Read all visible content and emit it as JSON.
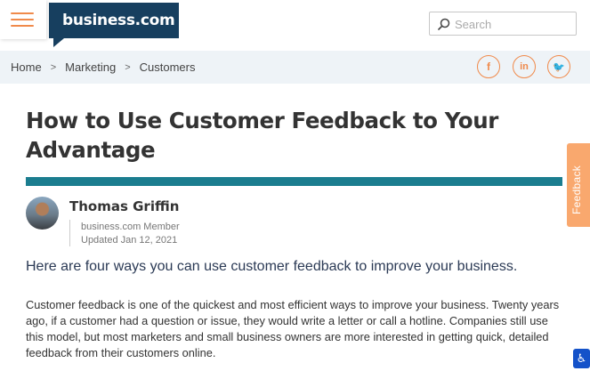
{
  "header": {
    "logo_text": "business.com",
    "search_placeholder": "Search"
  },
  "breadcrumb": {
    "items": [
      "Home",
      "Marketing",
      "Customers"
    ],
    "separator": ">"
  },
  "social": [
    {
      "icon": "facebook-icon",
      "glyph": "f"
    },
    {
      "icon": "linkedin-icon",
      "glyph": "in"
    },
    {
      "icon": "twitter-icon",
      "glyph": "🐦"
    }
  ],
  "article": {
    "title": "How to Use Customer Feedback to Your Advantage",
    "author": "Thomas Griffin",
    "author_role": "business.com Member",
    "updated": "Updated Jan 12, 2021",
    "lead": "Here are four ways you can use customer feedback to improve your business.",
    "body": "Customer feedback is one of the quickest and most efficient ways to improve your business. Twenty years ago, if a customer had a question or issue, they would write a letter or call a hotline. Companies still use this model, but most marketers and small business owners are more interested in getting quick, detailed feedback from their customers online."
  },
  "feedback_tab": "Feedback",
  "colors": {
    "accent": "#f08a4b",
    "logo_bg": "#173f5f",
    "rule": "#1b7d8f",
    "lead_text": "#2b3a55"
  }
}
